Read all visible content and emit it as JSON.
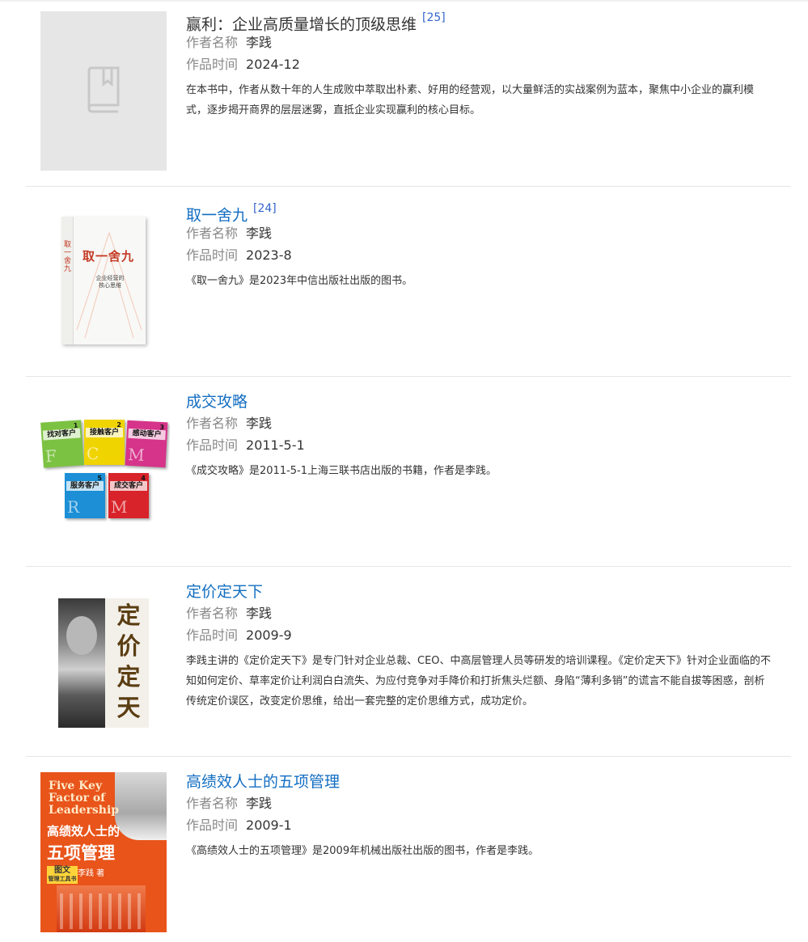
{
  "books": [
    {
      "title": "赢利：企业高质量增长的顶级思维",
      "ref": "[25]",
      "author_label": "作者名称",
      "author": "李践",
      "time_label": "作品时间",
      "time": "2024-12",
      "desc": "在本书中，作者从数十年的人生成败中萃取出朴素、好用的经营观，以大量鲜活的实战案例为蓝本，聚焦中小企业的赢利模式，逐步揭开商界的层层迷雾，直抵企业实现赢利的核心目标。",
      "cover": "book-placeholder-icon"
    },
    {
      "title": "取一舍九",
      "ref": "[24]",
      "author_label": "作者名称",
      "author": "李践",
      "time_label": "作品时间",
      "time": "2023-8",
      "desc": "《取一舍九》是2023年中信出版社出版的图书。",
      "cover_text": {
        "title": "取一舍九",
        "subtitle": "企业经营的核心思维"
      }
    },
    {
      "title": "成交攻略",
      "ref": "",
      "author_label": "作者名称",
      "author": "李践",
      "time_label": "作品时间",
      "time": "2011-5-1",
      "desc": "《成交攻略》是2011-5-1上海三联书店出版的书籍，作者是李践。",
      "cover_text": {
        "vol1": "找对客户",
        "vol1_num": "1",
        "vol2": "接触客户",
        "vol2_num": "2",
        "vol3": "感动客户",
        "vol3_num": "3",
        "vol4": "成交客户",
        "vol4_num": "4",
        "vol5": "服务客户",
        "vol5_num": "5"
      }
    },
    {
      "title": "定价定天下",
      "ref": "",
      "author_label": "作者名称",
      "author": "李践",
      "time_label": "作品时间",
      "time": "2009-9",
      "desc": "李践主讲的《定价定天下》是专门针对企业总裁、CEO、中高层管理人员等研发的培训课程。《定价定天下》针对企业面临的不知如何定价、草率定价让利润白白流失、为应付竞争对手降价和打折焦头烂额、身陷“薄利多销”的谎言不能自拔等困惑，剖析传统定价误区，改变定价思维，给出一套完整的定价思维方式，成功定价。",
      "cover_text": {
        "title": "定价定天下"
      }
    },
    {
      "title": "高绩效人士的五项管理",
      "ref": "",
      "author_label": "作者名称",
      "author": "李践",
      "time_label": "作品时间",
      "time": "2009-1",
      "desc": "《高绩效人士的五项管理》是2009年机械出版社出版的图书，作者是李践。",
      "cover_text": {
        "en1": "Five Key",
        "en2": "Factor of",
        "en3": "Leadership",
        "zh1": "高绩效人士的",
        "zh2": "五项管理",
        "tag": "图文",
        "tag2": "管理工具书",
        "author": "李践 著"
      }
    }
  ]
}
